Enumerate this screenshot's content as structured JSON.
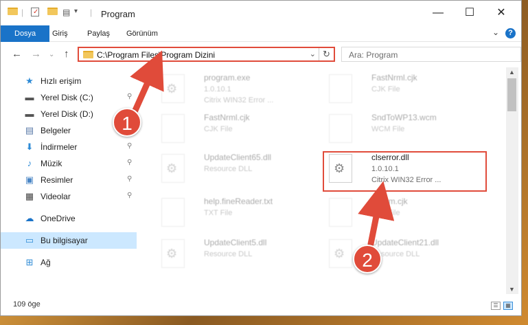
{
  "window": {
    "title": "Program",
    "controls": {
      "minimize": "—",
      "maximize": "☐",
      "close": "✕"
    }
  },
  "quick_access_toolbar": {
    "dropdown": "▾"
  },
  "ribbon": {
    "tabs": [
      "Dosya",
      "Giriş",
      "Paylaş",
      "Görünüm"
    ],
    "expand": "⌄",
    "help": "?"
  },
  "navigation": {
    "back": "←",
    "forward": "→",
    "up": "↑",
    "address": "C:\\Program Files\\Program Dizini",
    "address_dropdown": "⌄",
    "refresh": "↻",
    "search_placeholder": "Ara: Program"
  },
  "sidebar": {
    "items": [
      {
        "label": "Hızlı erişim",
        "icon": "star-icon",
        "glyph": "★",
        "color": "#2e8bd6",
        "pinned": false
      },
      {
        "label": "Yerel Disk (C:)",
        "icon": "drive-icon",
        "glyph": "▬",
        "color": "#555555",
        "pinned": true
      },
      {
        "label": "Yerel Disk (D:)",
        "icon": "drive-icon",
        "glyph": "▬",
        "color": "#555555",
        "pinned": true
      },
      {
        "label": "Belgeler",
        "icon": "documents-icon",
        "glyph": "▤",
        "color": "#5a7aa8",
        "pinned": true
      },
      {
        "label": "İndirmeler",
        "icon": "download-icon",
        "glyph": "⬇",
        "color": "#2e8bd6",
        "pinned": true
      },
      {
        "label": "Müzik",
        "icon": "music-icon",
        "glyph": "♪",
        "color": "#2e8bd6",
        "pinned": true
      },
      {
        "label": "Resimler",
        "icon": "pictures-icon",
        "glyph": "▣",
        "color": "#4a86c5",
        "pinned": true
      },
      {
        "label": "Videolar",
        "icon": "videos-icon",
        "glyph": "▦",
        "color": "#444444",
        "pinned": true
      },
      {
        "label": "OneDrive",
        "icon": "cloud-icon",
        "glyph": "☁",
        "color": "#1a73c8",
        "pinned": false
      },
      {
        "label": "Bu bilgisayar",
        "icon": "computer-icon",
        "glyph": "▭",
        "color": "#2e8bd6",
        "pinned": false
      },
      {
        "label": "Ağ",
        "icon": "network-icon",
        "glyph": "⊞",
        "color": "#2e8bd6",
        "pinned": false
      }
    ],
    "pin_glyph": "📌"
  },
  "files": [
    {
      "name": "program.exe",
      "line1": "1.0.10.1",
      "line2": "Citrix WIN32 Error ...",
      "kind": "dll"
    },
    {
      "name": "FastNrml.cjk",
      "line1": "CJK File",
      "line2": "",
      "kind": "doc"
    },
    {
      "name": "FastNrml.cjk",
      "line1": "CJK File",
      "line2": "",
      "kind": "doc"
    },
    {
      "name": "SndToWP13.wcm",
      "line1": "WCM File",
      "line2": "",
      "kind": "doc"
    },
    {
      "name": "UpdateClient65.dll",
      "line1": "Resource DLL",
      "line2": "",
      "kind": "dll"
    },
    {
      "name": "clserror.dll",
      "line1": "1.0.10.1",
      "line2": "Citrix WIN32 Error ...",
      "kind": "dll"
    },
    {
      "name": "help.fineReader.txt",
      "line1": "TXT File",
      "line2": "",
      "kind": "doc"
    },
    {
      "name": "Kat..m.cjk",
      "line1": "CJK File",
      "line2": "",
      "kind": "doc"
    },
    {
      "name": "UpdateClient5.dll",
      "line1": "Resource DLL",
      "line2": "",
      "kind": "dll"
    },
    {
      "name": "UpdateClient21.dll",
      "line1": "Resource DLL",
      "line2": "",
      "kind": "dll"
    }
  ],
  "status": {
    "item_count": "109 öge"
  },
  "annotations": [
    {
      "number": "1"
    },
    {
      "number": "2"
    }
  ],
  "colors": {
    "accent": "#1a73c8",
    "annotation": "#e04b3a",
    "selection": "#cce8ff"
  }
}
